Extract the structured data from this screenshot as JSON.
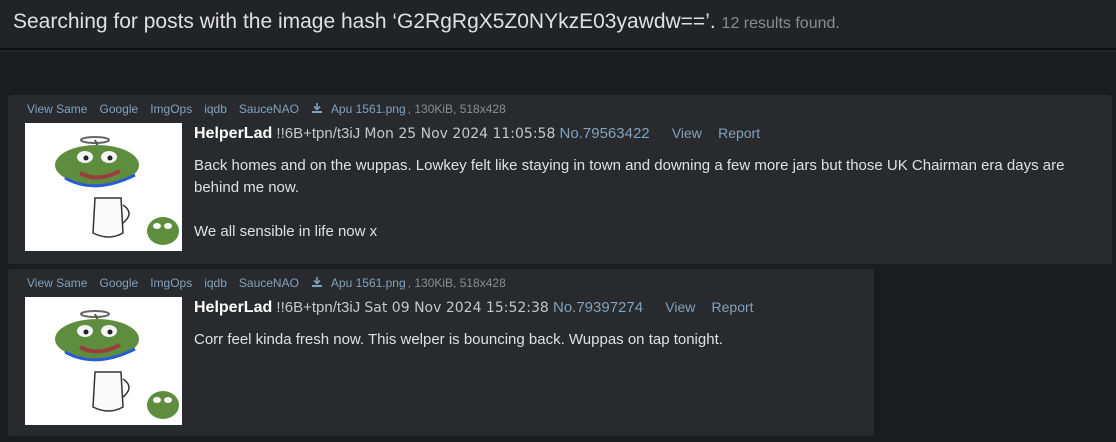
{
  "header": {
    "title": "Searching for posts with the image hash ‘G2RgRgX5Z0NYkzE03yawdw==’.",
    "count": "12 results found."
  },
  "posts": [
    {
      "actions": [
        "View Same",
        "Google",
        "ImgOps",
        "iqdb",
        "SauceNAO"
      ],
      "filename": "Apu 1561.png",
      "filemeta": ", 130KiB, 518x428",
      "name": "HelperLad",
      "trip": "!!6B+tpn/t3iJ",
      "date": "Mon 25 Nov 2024 11:05:58",
      "number": "No.79563422",
      "view": "View",
      "report": "Report",
      "body": [
        "Back homes and on the wuppas. Lowkey felt like staying in town and downing a few more jars but those UK Chairman era days are behind me now.",
        "We all sensible in life now x"
      ]
    },
    {
      "actions": [
        "View Same",
        "Google",
        "ImgOps",
        "iqdb",
        "SauceNAO"
      ],
      "filename": "Apu 1561.png",
      "filemeta": ", 130KiB, 518x428",
      "name": "HelperLad",
      "trip": "!!6B+tpn/t3iJ",
      "date": "Sat 09 Nov 2024 15:52:38",
      "number": "No.79397274",
      "view": "View",
      "report": "Report",
      "body": [
        "Corr feel kinda fresh now. This welper is bouncing back. Wuppas on tap tonight."
      ]
    }
  ]
}
